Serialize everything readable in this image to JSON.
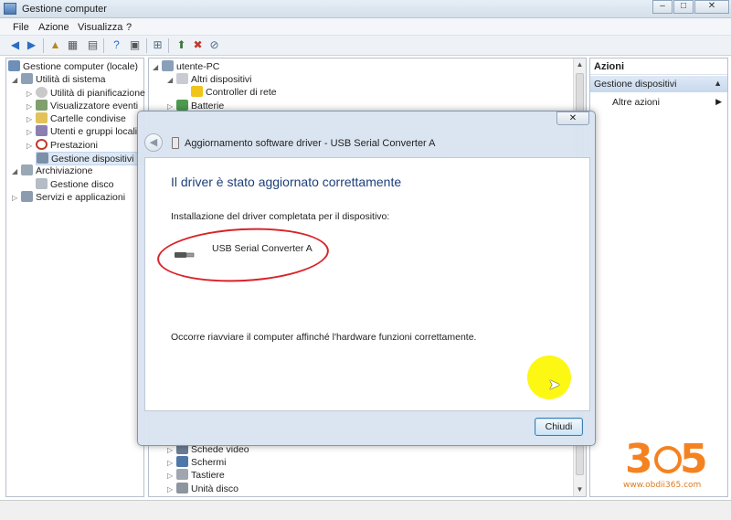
{
  "window": {
    "title": "Gestione computer"
  },
  "menu": [
    "File",
    "Azione",
    "Visualizza",
    "?"
  ],
  "left_tree": [
    {
      "label": "Gestione computer (locale)"
    },
    {
      "label": "Utilità di sistema"
    },
    {
      "label": "Utilità di pianificazione"
    },
    {
      "label": "Visualizzatore eventi"
    },
    {
      "label": "Cartelle condivise"
    },
    {
      "label": "Utenti e gruppi locali"
    },
    {
      "label": "Prestazioni"
    },
    {
      "label": "Gestione dispositivi"
    },
    {
      "label": "Archiviazione"
    },
    {
      "label": "Gestione disco"
    },
    {
      "label": "Servizi e applicazioni"
    }
  ],
  "device_tree": [
    {
      "label": "utente-PC"
    },
    {
      "label": "Altri dispositivi"
    },
    {
      "label": "Controller di rete"
    },
    {
      "label": "Batterie"
    },
    {
      "label": "Schede video"
    },
    {
      "label": "Schermi"
    },
    {
      "label": "Tastiere"
    },
    {
      "label": "Unità disco"
    }
  ],
  "actions": {
    "header": "Azioni",
    "selected": "Gestione dispositivi",
    "more": "Altre azioni"
  },
  "dialog": {
    "title": "Aggiornamento software driver - USB Serial Converter A",
    "heading": "Il driver è stato aggiornato correttamente",
    "install_text": "Installazione del driver completata per il dispositivo:",
    "device_name": "USB Serial Converter A",
    "restart_text": "Occorre riavviare il computer affinché l'hardware funzioni correttamente.",
    "close_button": "Chiudi"
  },
  "watermark": {
    "digit_left": "3",
    "digit_right": "5",
    "url": "www.obdii365.com"
  },
  "colors": {
    "accent": "#1d3f7a",
    "highlight_ellipse": "#d9232a",
    "cursor_highlight": "#fdf600",
    "watermark": "#f58220"
  }
}
